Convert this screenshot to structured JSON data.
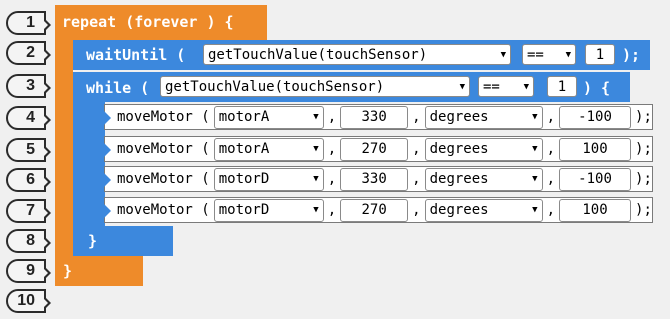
{
  "line_numbers": [
    "1",
    "2",
    "3",
    "4",
    "5",
    "6",
    "7",
    "8",
    "9",
    "10"
  ],
  "repeat": {
    "open": "repeat (forever ) {",
    "close": "}"
  },
  "wait_until": {
    "keyword": "waitUntil (",
    "sensor_call": "getTouchValue(touchSensor)",
    "operator": "==",
    "value": "1",
    "close": ");"
  },
  "while_loop": {
    "keyword": "while (",
    "sensor_call": "getTouchValue(touchSensor)",
    "operator": "==",
    "value": "1",
    "open_close": ") {",
    "close": "}"
  },
  "move_motor_rows": [
    {
      "function": "moveMotor (",
      "motor": "motorA",
      "amount": "330",
      "unit": "degrees",
      "power": "-100",
      "end": ");"
    },
    {
      "function": "moveMotor (",
      "motor": "motorA",
      "amount": "270",
      "unit": "degrees",
      "power": "100",
      "end": ");"
    },
    {
      "function": "moveMotor (",
      "motor": "motorD",
      "amount": "330",
      "unit": "degrees",
      "power": "-100",
      "end": ");"
    },
    {
      "function": "moveMotor (",
      "motor": "motorD",
      "amount": "270",
      "unit": "degrees",
      "power": "100",
      "end": ");"
    }
  ],
  "separator": ",",
  "icons": {
    "dropdown": "dropdown-arrow-icon"
  }
}
